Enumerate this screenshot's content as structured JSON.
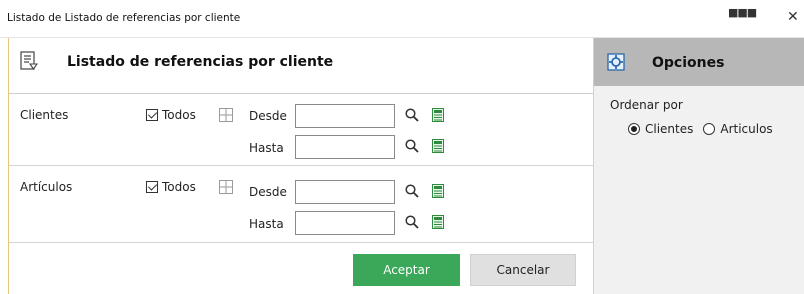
{
  "window": {
    "title": "Listado de Listado de referencias por cliente",
    "dots": "■■■",
    "close": "✕"
  },
  "main": {
    "heading": "Listado de referencias por cliente",
    "sections": [
      {
        "label": "Clientes",
        "todos_label": "Todos",
        "todos_checked": true,
        "desde_label": "Desde",
        "desde_value": "",
        "hasta_label": "Hasta",
        "hasta_value": ""
      },
      {
        "label": "Artículos",
        "todos_label": "Todos",
        "todos_checked": true,
        "desde_label": "Desde",
        "desde_value": "",
        "hasta_label": "Hasta",
        "hasta_value": ""
      }
    ],
    "buttons": {
      "accept": "Aceptar",
      "cancel": "Cancelar"
    }
  },
  "panel": {
    "title": "Opciones",
    "order_label": "Ordenar por",
    "options": [
      {
        "label": "Clientes",
        "selected": true
      },
      {
        "label": "Articulos",
        "selected": false
      }
    ]
  },
  "colors": {
    "accept_bg": "#3aa858",
    "panel_header": "#b7b7b7",
    "sheet_icon": "#2e8b3e"
  }
}
